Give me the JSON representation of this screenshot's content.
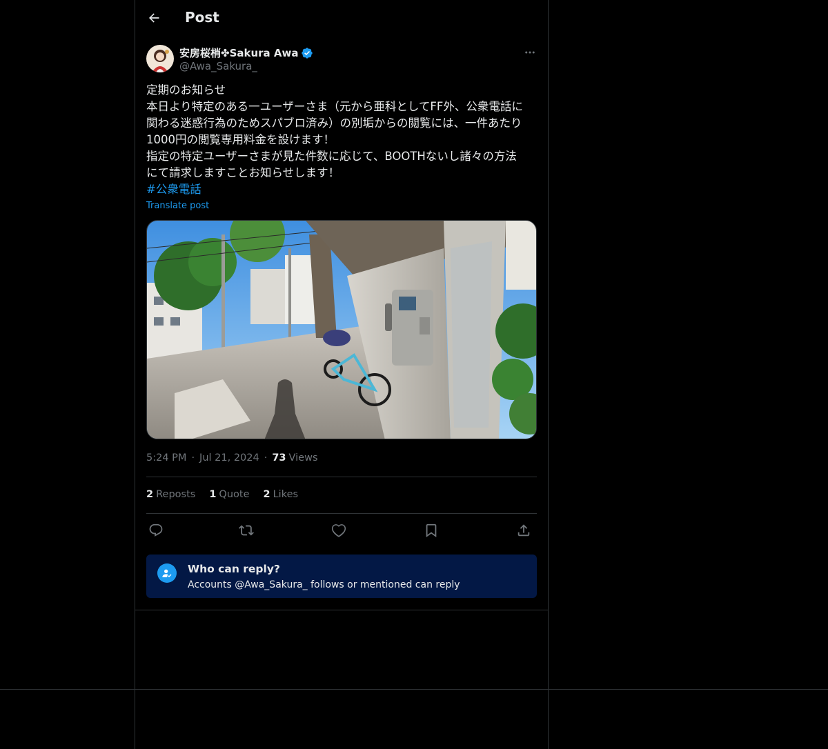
{
  "header": {
    "title": "Post",
    "back_icon": "arrow-left-icon"
  },
  "post": {
    "author": {
      "display_name": "安房桜梢✤Sakura Awa",
      "handle": "@Awa_Sakura_",
      "verified": true,
      "verified_color": "#1d9bf0"
    },
    "text_lines": [
      "定期のお知らせ",
      "本日より特定のある一ユーザーさま（元から亜科としてFF外、公衆電話に",
      "関わる迷惑行為のためスパブロ済み）の別垢からの閲覧には、一件あたり",
      "1000円の閲覧専用料金を設けます！",
      "指定の特定ユーザーさまが見た件数に応じて、BOOTHないし諸々の方法",
      "にて請求しますことお知らせします！"
    ],
    "hashtag": "#公衆電話",
    "translate_label": "Translate post",
    "media_description_icon": "photo-public-phone-booth",
    "time": "5:24 PM",
    "date": "Jul 21, 2024",
    "views_count": "73",
    "views_label": "Views",
    "stats": {
      "reposts_count": "2",
      "reposts_label": "Reposts",
      "quotes_count": "1",
      "quotes_label": "Quote",
      "likes_count": "2",
      "likes_label": "Likes"
    },
    "separator": "·"
  },
  "actions": {
    "reply_icon": "speech-bubble-icon",
    "repost_icon": "repost-icon",
    "like_icon": "heart-icon",
    "bookmark_icon": "bookmark-icon",
    "share_icon": "share-icon"
  },
  "reply_restriction": {
    "title": "Who can reply?",
    "description": "Accounts @Awa_Sakura_ follows or mentioned can reply",
    "icon": "user-check-icon"
  },
  "colors": {
    "background": "#000000",
    "text_primary": "#e7e9ea",
    "text_secondary": "#71767b",
    "accent": "#1d9bf0",
    "border": "#2f3336",
    "reply_box_bg": "#031845"
  }
}
